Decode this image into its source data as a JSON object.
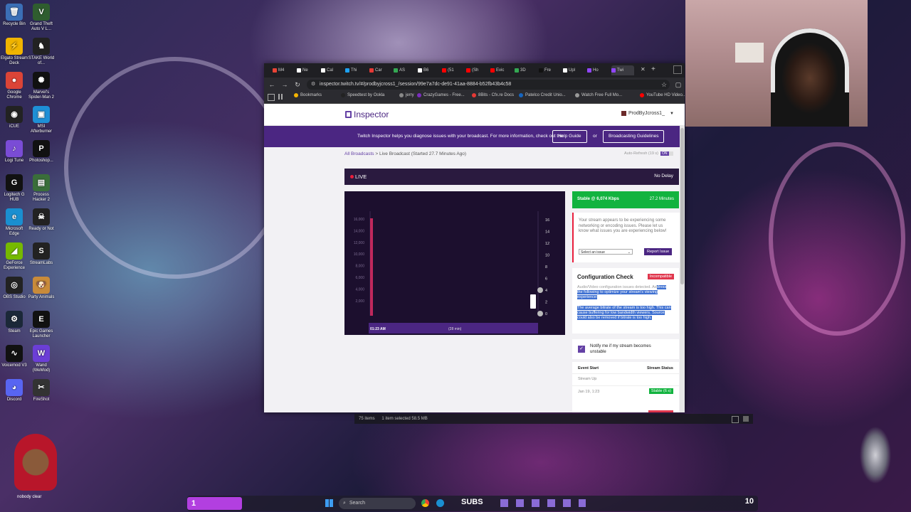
{
  "desktop": {
    "icons": [
      {
        "label": "Recycle Bin",
        "glyph": "🗑",
        "color": "#3b6fb6"
      },
      {
        "label": "Grand Theft Auto V L...",
        "glyph": "V",
        "color": "#2f5d2f"
      },
      {
        "label": "Elgato Stream Deck",
        "glyph": "⚡",
        "color": "#f0b400"
      },
      {
        "label": "STAKE World of...",
        "glyph": "♞",
        "color": "#222"
      },
      {
        "label": "Google Chrome",
        "glyph": "●",
        "color": "#db4437"
      },
      {
        "label": "Marvel's Spider-Man 2",
        "glyph": "✺",
        "color": "#111"
      },
      {
        "label": "iCUE",
        "glyph": "◉",
        "color": "#222"
      },
      {
        "label": "MSI Afterburner",
        "glyph": "▣",
        "color": "#1e8fd6"
      },
      {
        "label": "Logi Tune",
        "glyph": "♪",
        "color": "#7a4cd6"
      },
      {
        "label": "Photoshop...",
        "glyph": "P",
        "color": "#111"
      },
      {
        "label": "Logitech G HUB",
        "glyph": "G",
        "color": "#111"
      },
      {
        "label": "Process Hacker 2",
        "glyph": "▤",
        "color": "#3a6e3a"
      },
      {
        "label": "Microsoft Edge",
        "glyph": "e",
        "color": "#1a8fd0"
      },
      {
        "label": "Ready or Not",
        "glyph": "☠",
        "color": "#222"
      },
      {
        "label": "GeForce Experience",
        "glyph": "◢",
        "color": "#76b900"
      },
      {
        "label": "StreamLabs",
        "glyph": "S",
        "color": "#222"
      },
      {
        "label": "OBS Studio",
        "glyph": "◎",
        "color": "#222"
      },
      {
        "label": "Party Animals",
        "glyph": "🐶",
        "color": "#c98b3a"
      },
      {
        "label": "Steam",
        "glyph": "⚙",
        "color": "#1b2838"
      },
      {
        "label": "Epic Games Launcher",
        "glyph": "E",
        "color": "#111"
      },
      {
        "label": "Voicemod V3",
        "glyph": "∿",
        "color": "#111"
      },
      {
        "label": "Wand (WeMod)",
        "glyph": "W",
        "color": "#6b3ed6"
      },
      {
        "label": "Discord",
        "glyph": "◕",
        "color": "#5865f2"
      },
      {
        "label": "FireShot",
        "glyph": "✂",
        "color": "#333"
      }
    ]
  },
  "browser": {
    "tabs": [
      {
        "label": "M4",
        "color": "#ea4335"
      },
      {
        "label": "Ne",
        "color": "#ffffff"
      },
      {
        "label": "Cal",
        "color": "#ffffff"
      },
      {
        "label": "Thi",
        "color": "#1da1f2"
      },
      {
        "label": "Car",
        "color": "#e53935"
      },
      {
        "label": "AS",
        "color": "#34a853"
      },
      {
        "label": "B6",
        "color": "#ffffff"
      },
      {
        "label": "(51",
        "color": "#ff0000"
      },
      {
        "label": "(Sh",
        "color": "#ff0000"
      },
      {
        "label": "Evic",
        "color": "#ff0000"
      },
      {
        "label": "3D",
        "color": "#34a853"
      },
      {
        "label": "Fre",
        "color": "#111111"
      },
      {
        "label": "Upl",
        "color": "#ffffff"
      },
      {
        "label": "Ho",
        "color": "#9146ff"
      },
      {
        "label": "Twi",
        "color": "#9146ff"
      }
    ],
    "url": "inspector.twitch.tv/#/prodbyjcross1_/session/99e7a7dc-de91-41aa-8884-b52fb43b4c58",
    "bookmarks": [
      {
        "label": "Bookmarks",
        "color": "#f4b400"
      },
      {
        "label": "Speedtest by Ookla",
        "color": "#222222"
      },
      {
        "label": "jerry",
        "color": "#888888"
      },
      {
        "label": "CrazyGames - Free...",
        "color": "#7b2cbf"
      },
      {
        "label": "8Bits - Cfx.re Docs",
        "color": "#e53935"
      },
      {
        "label": "Patelco Credit Unio...",
        "color": "#1565c0"
      },
      {
        "label": "Watch Free Full Mo...",
        "color": "#999999"
      },
      {
        "label": "YouTube HD Video...",
        "color": "#ff0000"
      }
    ]
  },
  "inspector": {
    "logo": "Inspector",
    "user": "ProdByJcross1_",
    "banner_text": "Twitch Inspector helps you diagnose issues with your broadcast. For more information, check out the",
    "help_guide": "Help Guide",
    "or": "or",
    "broadcasting_guidelines": "Broadcasting Guidelines",
    "breadcrumb_root": "All Broadcasts",
    "breadcrumb_sep": ">",
    "breadcrumb_current": "Live Broadcast (Started 27.7 Minutes Ago)",
    "auto_refresh": "Auto-Refresh (19 s)",
    "auto_refresh_toggle": "ON",
    "live_label": "LIVE",
    "delay_label": "No Delay",
    "stable_label": "Stable @ 6,074 Kbps",
    "stable_time": "27.2 Minutes",
    "issue_text": "Your stream appears to be experiencing some networking or encoding issues. Please let us know what issues you are experiencing below!",
    "select_issue": "Select an issue",
    "report_issue": "Report Issue",
    "config_title": "Configuration Check",
    "config_badge": "Incompatible",
    "config_text_plain": "Audio/Video configuration issues detected. Ad",
    "config_text_selected": "dress the following to optimize your stream's viewing experience:",
    "config_detail": "The average bitrate of the stream is too high. This can cause buffering for low bandwidth viewers. Source could also be removed if bitrate is too high.",
    "notify_label": "Notify me if my stream becomes unstable",
    "event_start_header": "Event Start",
    "stream_status_header": "Stream Status",
    "event_rows": [
      {
        "event": "Stream Up",
        "status": ""
      },
      {
        "event": "Jan 19, 1:23",
        "status": "Stable (6 s)"
      }
    ]
  },
  "chart_data": {
    "type": "line",
    "title": "",
    "x": [
      "01:23 AM",
      "(28 min)"
    ],
    "y_left_ticks": [
      "16,000",
      "14,000",
      "12,000",
      "10,000",
      "8,000",
      "6,000",
      "4,000",
      "2,000"
    ],
    "y_right_ticks": [
      "16",
      "14",
      "12",
      "10",
      "8",
      "6",
      "4",
      "2",
      "0"
    ],
    "series": [
      {
        "values": [
          16000,
          16000
        ]
      }
    ],
    "colors": {
      "bar": "#c0285c",
      "bg": "#1c0f2e"
    }
  },
  "taskbar": {
    "left_badge": "1",
    "search_label": "Search",
    "subs_label": "SUBS",
    "right_badge": "10"
  },
  "explorer_status": {
    "items": "75 items",
    "selected": "1 item selected  58.5 MB"
  },
  "webcam_overlay": {
    "caption": "nobody clear"
  }
}
